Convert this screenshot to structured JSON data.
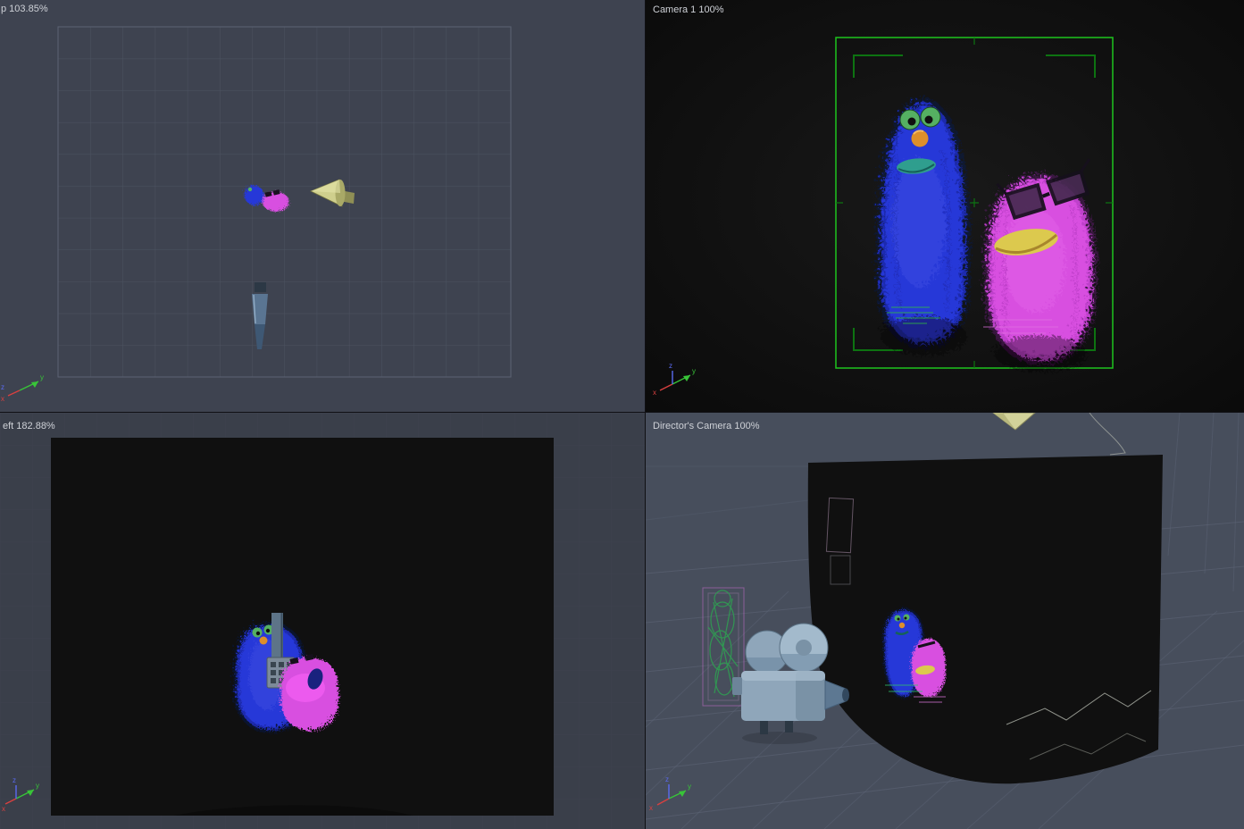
{
  "viewports": {
    "top": {
      "label": "p 103.85%",
      "zoom": "103.85%"
    },
    "camera1": {
      "label": "Camera 1 100%",
      "zoom": "100%"
    },
    "left": {
      "label": "eft 182.88%",
      "zoom": "182.88%"
    },
    "directors": {
      "label": "Director's Camera 100%",
      "zoom": "100%"
    }
  },
  "gizmo": {
    "x": "x",
    "y": "y",
    "z": "z"
  },
  "colors": {
    "ortho_bg": "#3e4350",
    "side_bg": "#3a3f4a",
    "persp_bg": "#474e5c",
    "grid_line": "#4c5361",
    "camera_view_bg": "#111111",
    "backdrop_black": "#101010",
    "frame_green": "#1ec41e",
    "bracket_green": "#0d7311",
    "puppet_blue": "#2838d8",
    "puppet_magenta": "#d84fe0",
    "eye_green": "#55b062",
    "nose_orange": "#dd8f2b",
    "mouth_teal": "#2f9e8e",
    "mouth_yellow": "#dcc94e",
    "camera_body": "#8fa6ba",
    "cone_khaki": "#cfcf8d",
    "wire_green": "#2f9e52",
    "wire_magenta": "#d070d8",
    "active_border": "#a8a55a",
    "axis_red": "#d84040",
    "axis_green": "#38c438",
    "axis_blue": "#5a6af0",
    "label_text": "#ced1d7"
  }
}
